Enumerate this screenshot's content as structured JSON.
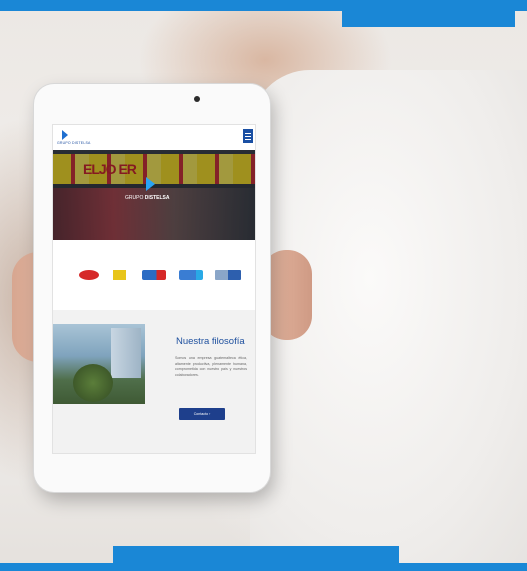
{
  "banner": {
    "accent_color": "#1a87d6"
  },
  "site": {
    "logo_text": "GRUPO DISTELSA",
    "menu_icon": "hamburger-icon",
    "hero": {
      "sign_text": "ELJO  ER",
      "logo_prefix": "GRUPO ",
      "logo_bold": "DISTELSA"
    },
    "brands": [
      "Max",
      "Elektra",
      "Spirit",
      "Unicomer",
      "Tigo"
    ],
    "philosophy": {
      "title": "Nuestra filosofía",
      "body": "Somos una empresa guatemalteca ética, altamente productiva, plenamente humana, comprometida con nuestro país y nuestros colaboradores.",
      "button_label": "Contacto  ›"
    },
    "colors": {
      "primary": "#1e3f8c",
      "title": "#1d4f9e",
      "logo_accent": "#2aa4f4"
    }
  }
}
